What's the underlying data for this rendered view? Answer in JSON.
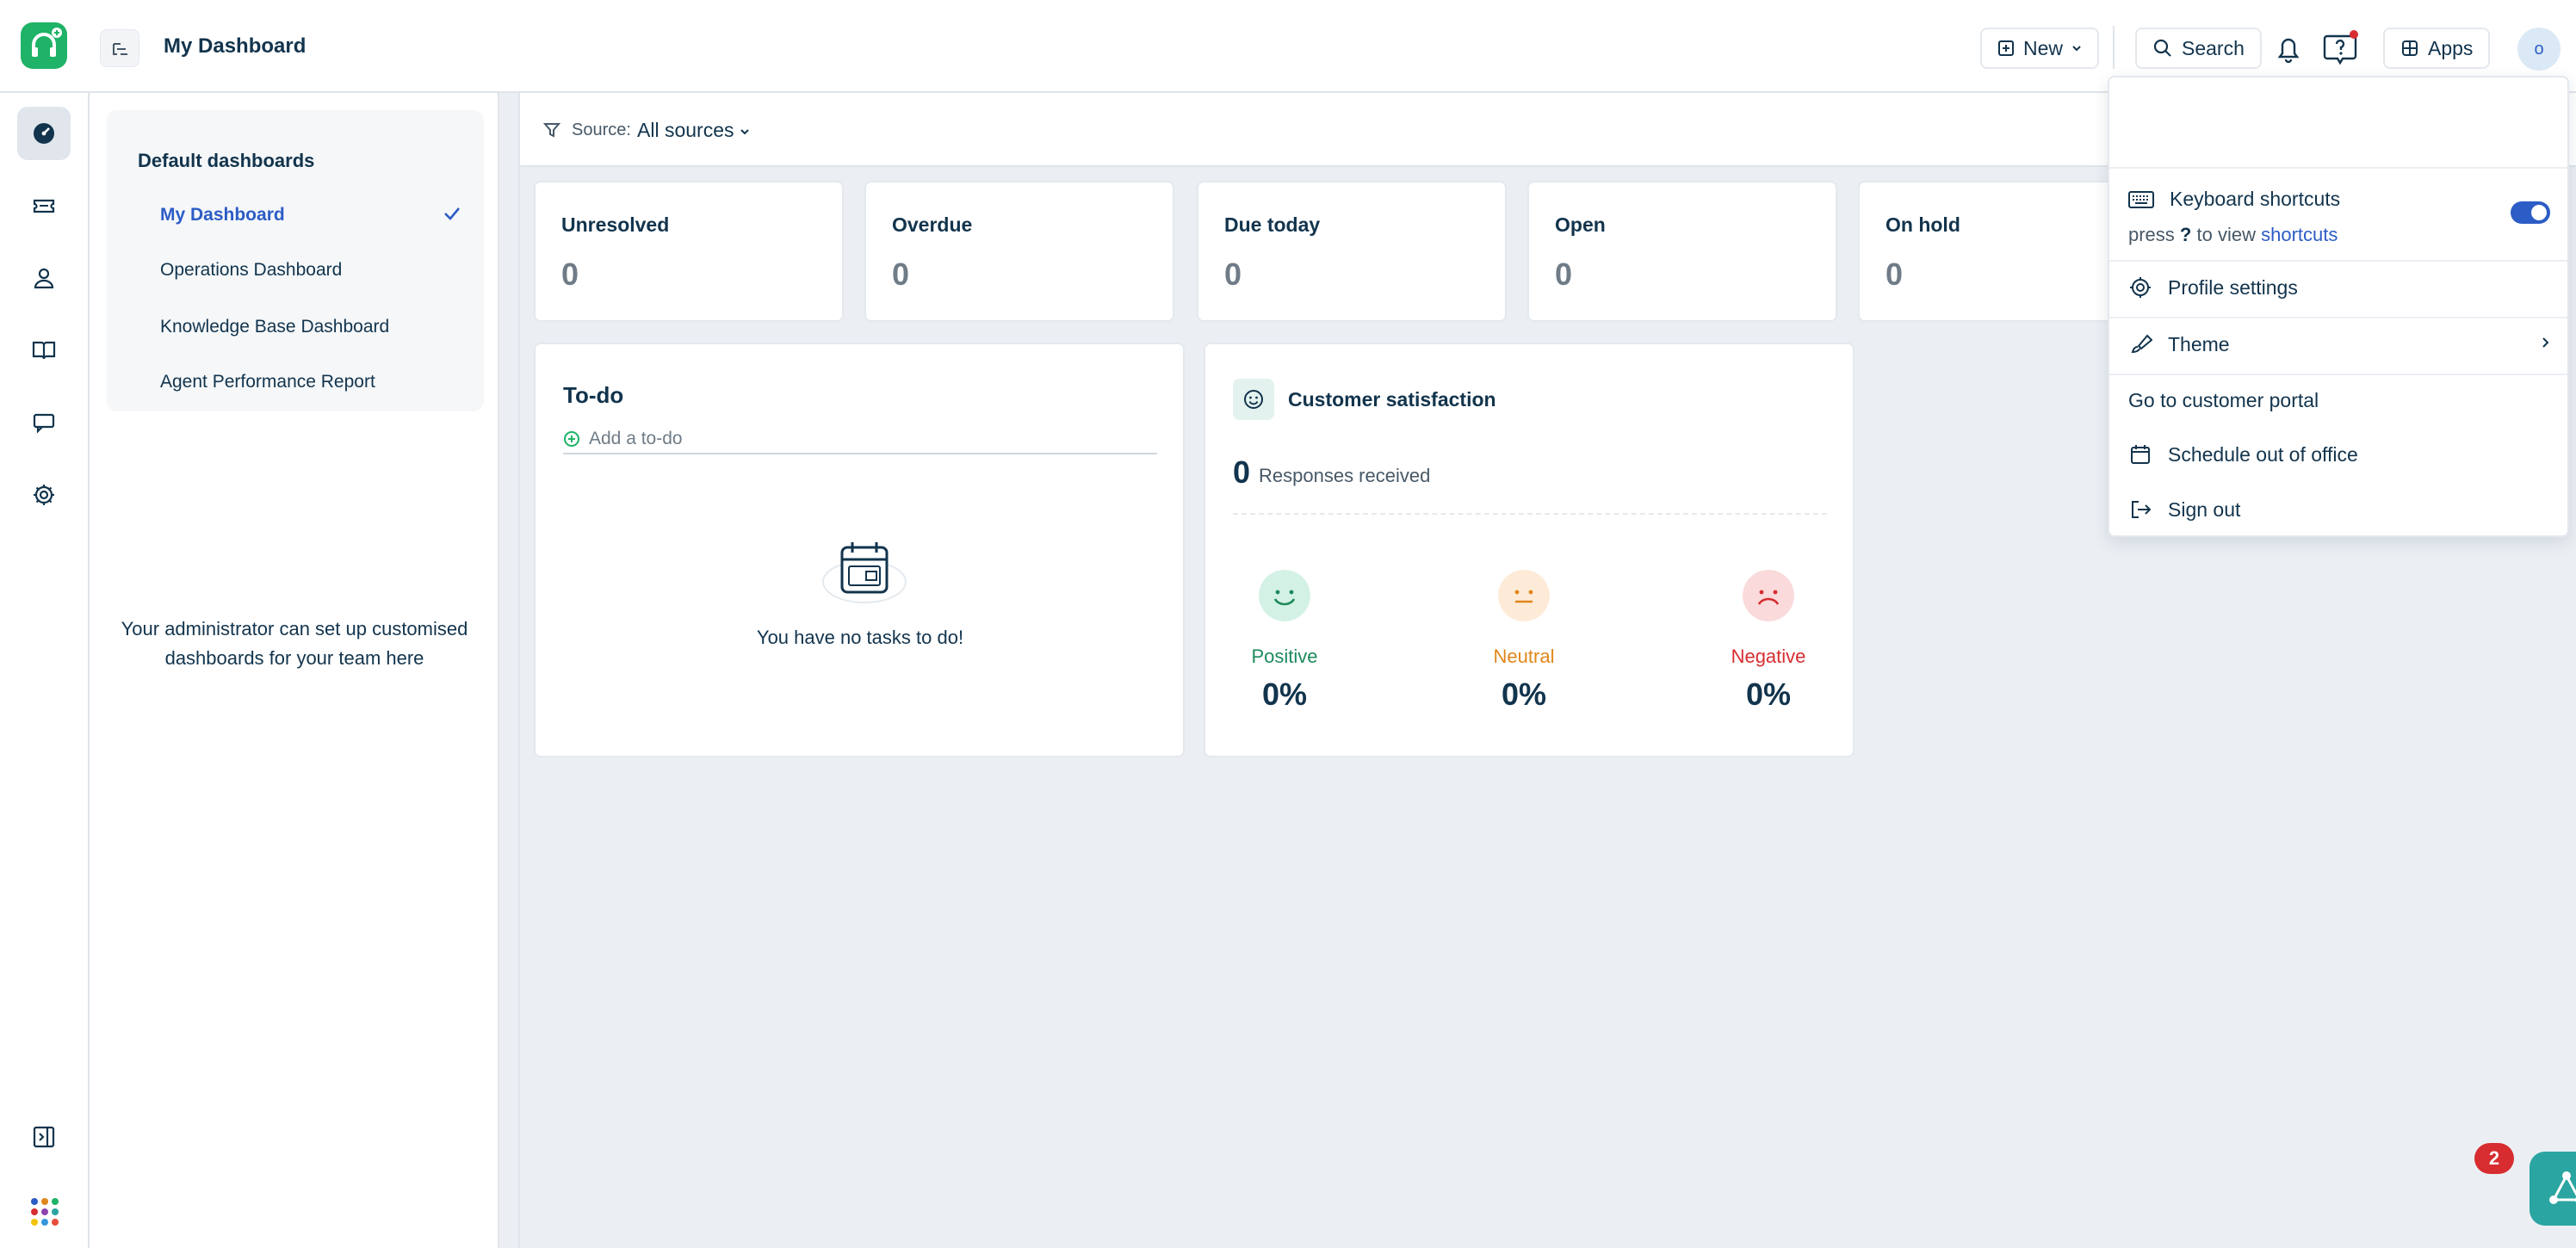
{
  "header": {
    "title": "My Dashboard",
    "new_label": "New",
    "search_label": "Search",
    "apps_label": "Apps",
    "avatar_initial": "o"
  },
  "dashboards": {
    "section_title": "Default dashboards",
    "items": [
      {
        "label": "My Dashboard",
        "active": true
      },
      {
        "label": "Operations Dashboard",
        "active": false
      },
      {
        "label": "Knowledge Base Dashboard",
        "active": false
      },
      {
        "label": "Agent Performance Report",
        "active": false
      }
    ],
    "note": "Your administrator can set up customised dashboards for your team here"
  },
  "filter": {
    "source_label": "Source:",
    "source_value": "All sources"
  },
  "stats": [
    {
      "title": "Unresolved",
      "value": "0"
    },
    {
      "title": "Overdue",
      "value": "0"
    },
    {
      "title": "Due today",
      "value": "0"
    },
    {
      "title": "Open",
      "value": "0"
    },
    {
      "title": "On hold",
      "value": "0"
    }
  ],
  "todo": {
    "title": "To-do",
    "add_placeholder": "Add a to-do",
    "empty_text": "You have no tasks to do!"
  },
  "csat": {
    "title": "Customer satisfaction",
    "count": "0",
    "count_label": "Responses received",
    "positive": {
      "label": "Positive",
      "pct": "0%",
      "color": "#1d8a5c"
    },
    "neutral": {
      "label": "Neutral",
      "pct": "0%",
      "color": "#e0861b"
    },
    "negative": {
      "label": "Negative",
      "pct": "0%",
      "color": "#d72d30"
    }
  },
  "menu": {
    "keyboard_shortcuts": "Keyboard shortcuts",
    "press": "press",
    "key": "?",
    "to_view": "to view",
    "shortcuts_link": "shortcuts",
    "profile_settings": "Profile settings",
    "theme": "Theme",
    "customer_portal": "Go to customer portal",
    "out_of_office": "Schedule out of office",
    "sign_out": "Sign out",
    "shortcuts_enabled": true
  },
  "notifications_badge": "2",
  "colors": {
    "brand": "#1eb366",
    "accent": "#2c5cc5",
    "fab": "#2aa5a2"
  }
}
